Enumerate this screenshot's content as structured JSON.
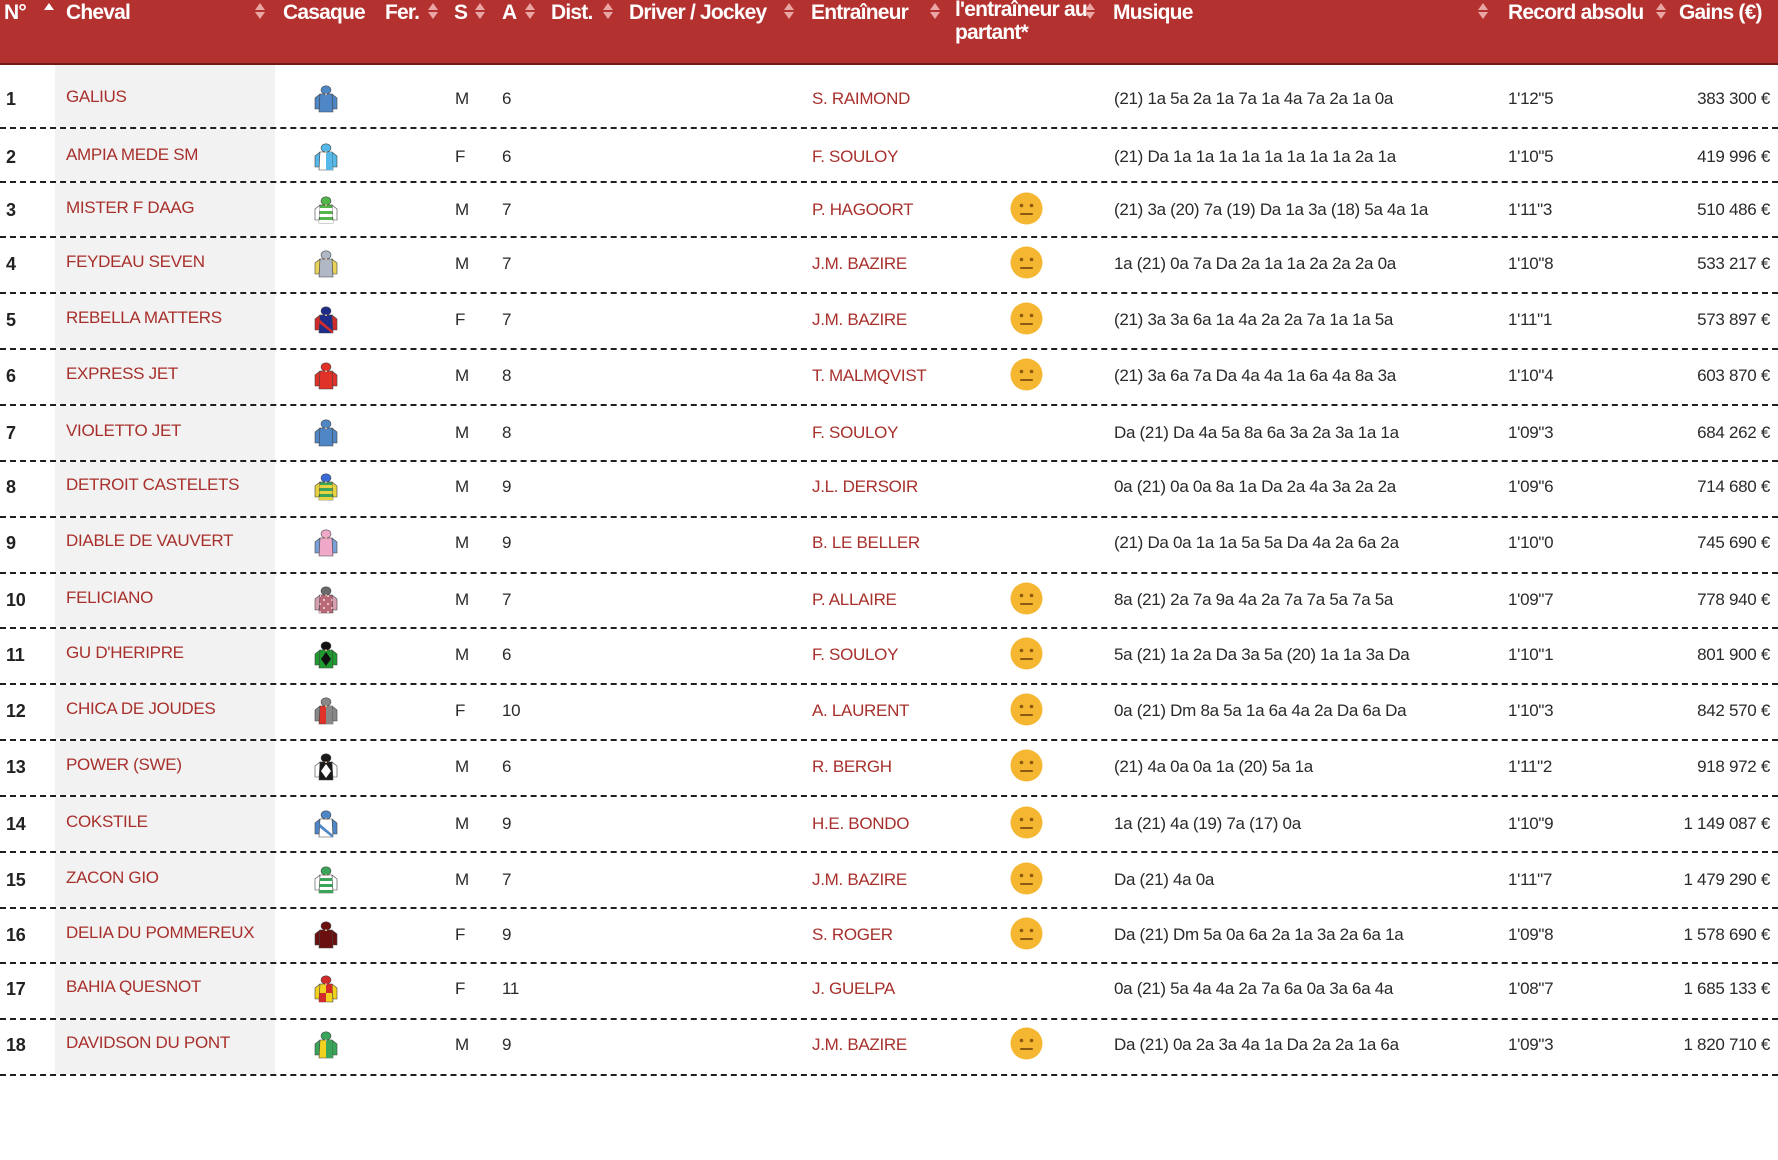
{
  "header": {
    "columns": [
      {
        "label": "N°",
        "sort": "none"
      },
      {
        "label": "Cheval",
        "sort": "asc"
      },
      {
        "label": "Casaque",
        "sort": "none"
      },
      {
        "label": "Fer.",
        "sort": "none"
      },
      {
        "label": "S",
        "sort": "none"
      },
      {
        "label": "A",
        "sort": "none"
      },
      {
        "label": "Dist.",
        "sort": "none"
      },
      {
        "label": "Driver / Jockey",
        "sort": "none"
      },
      {
        "label": "Entraîneur",
        "sort": "none"
      },
      {
        "label": "l'entraîneur au partant*",
        "sort": "none"
      },
      {
        "label": "Musique",
        "sort": "none"
      },
      {
        "label": "Record absolu",
        "sort": "none"
      },
      {
        "label": "Gains (€)",
        "sort": "none"
      }
    ]
  },
  "colors": {
    "header_bg": "#b3312f",
    "link": "#a8302c",
    "smiley": "#f5b731",
    "name_bg": "#f2f2f2"
  },
  "rows": [
    {
      "num": "1",
      "horse": "GALIUS",
      "silk": "blue",
      "sex": "M",
      "age": "6",
      "trainer": "S. RAIMOND",
      "smiley": false,
      "music": "(21) 1a 5a 2a 1a 7a 1a 4a 7a 2a 1a 0a",
      "record": "1'12\"5",
      "gains": "383 300 €"
    },
    {
      "num": "2",
      "horse": "AMPIA MEDE SM",
      "silk": "lightblue-white",
      "sex": "F",
      "age": "6",
      "trainer": "F. SOULOY",
      "smiley": false,
      "music": "(21) Da 1a 1a 1a 1a 1a 1a 1a 1a 2a 1a",
      "record": "1'10\"5",
      "gains": "419 996 €"
    },
    {
      "num": "3",
      "horse": "MISTER F DAAG",
      "silk": "green-stripes",
      "sex": "M",
      "age": "7",
      "trainer": "P. HAGOORT",
      "smiley": true,
      "music": "(21) 3a (20) 7a (19) Da 1a 3a (18) 5a 4a 1a",
      "record": "1'11\"3",
      "gains": "510 486 €"
    },
    {
      "num": "4",
      "horse": "FEYDEAU SEVEN",
      "silk": "grey-yellow",
      "sex": "M",
      "age": "7",
      "trainer": "J.M. BAZIRE",
      "smiley": true,
      "music": "1a (21) 0a 7a Da 2a 1a 1a 2a 2a 2a 0a",
      "record": "1'10\"8",
      "gains": "533 217 €"
    },
    {
      "num": "5",
      "horse": "REBELLA MATTERS",
      "silk": "navy-red",
      "sex": "F",
      "age": "7",
      "trainer": "J.M. BAZIRE",
      "smiley": true,
      "music": "(21) 3a 3a 6a 1a 4a 2a 2a 7a 1a 1a 5a",
      "record": "1'11\"1",
      "gains": "573 897 €"
    },
    {
      "num": "6",
      "horse": "EXPRESS JET",
      "silk": "red",
      "sex": "M",
      "age": "8",
      "trainer": "T. MALMQVIST",
      "smiley": true,
      "music": "(21) 3a 6a 7a Da 4a 4a 1a 6a 4a 8a 3a",
      "record": "1'10\"4",
      "gains": "603 870 €"
    },
    {
      "num": "7",
      "horse": "VIOLETTO JET",
      "silk": "blue",
      "sex": "M",
      "age": "8",
      "trainer": "F. SOULOY",
      "smiley": false,
      "music": "Da (21) Da 4a 5a 8a 6a 3a 2a 3a 1a 1a",
      "record": "1'09\"3",
      "gains": "684 262 €"
    },
    {
      "num": "8",
      "horse": "DETROIT CASTELETS",
      "silk": "green-yellow-blue",
      "sex": "M",
      "age": "9",
      "trainer": "J.L. DERSOIR",
      "smiley": false,
      "music": "0a (21) 0a 0a 8a 1a Da 2a 4a 3a 2a 2a",
      "record": "1'09\"6",
      "gains": "714 680 €"
    },
    {
      "num": "9",
      "horse": "DIABLE DE VAUVERT",
      "silk": "pink",
      "sex": "M",
      "age": "9",
      "trainer": "B. LE BELLER",
      "smiley": false,
      "music": "(21) Da 0a 1a 1a 5a 5a Da 4a 2a 6a 2a",
      "record": "1'10\"0",
      "gains": "745 690 €"
    },
    {
      "num": "10",
      "horse": "FELICIANO",
      "silk": "pink-check",
      "sex": "M",
      "age": "7",
      "trainer": "P. ALLAIRE",
      "smiley": true,
      "music": "8a (21) 2a 7a 9a 4a 2a 7a 7a 5a 7a 5a",
      "record": "1'09\"7",
      "gains": "778 940 €"
    },
    {
      "num": "11",
      "horse": "GU D'HERIPRE",
      "silk": "green-black",
      "sex": "M",
      "age": "6",
      "trainer": "F. SOULOY",
      "smiley": true,
      "music": "5a (21) 1a 2a Da 3a 5a (20) 1a 1a 3a Da",
      "record": "1'10\"1",
      "gains": "801 900 €"
    },
    {
      "num": "12",
      "horse": "CHICA DE JOUDES",
      "silk": "red-grey",
      "sex": "F",
      "age": "10",
      "trainer": "A. LAURENT",
      "smiley": true,
      "music": "0a (21) Dm 8a 5a 1a 6a 4a 2a Da 6a Da",
      "record": "1'10\"3",
      "gains": "842 570 €"
    },
    {
      "num": "13",
      "horse": "POWER (SWE)",
      "silk": "black-white",
      "sex": "M",
      "age": "6",
      "trainer": "R. BERGH",
      "smiley": true,
      "music": "(21) 4a 0a 0a 1a (20) 5a 1a",
      "record": "1'11\"2",
      "gains": "918 972 €"
    },
    {
      "num": "14",
      "horse": "COKSTILE",
      "silk": "blue-white",
      "sex": "M",
      "age": "9",
      "trainer": "H.E. BONDO",
      "smiley": true,
      "music": "1a (21) 4a (19) 7a (17) 0a",
      "record": "1'10\"9",
      "gains": "1 149 087 €"
    },
    {
      "num": "15",
      "horse": "ZACON GIO",
      "silk": "white-green",
      "sex": "M",
      "age": "7",
      "trainer": "J.M. BAZIRE",
      "smiley": true,
      "music": "Da (21) 4a 0a",
      "record": "1'11\"7",
      "gains": "1 479 290 €"
    },
    {
      "num": "16",
      "horse": "DELIA DU POMMEREUX",
      "silk": "maroon",
      "sex": "F",
      "age": "9",
      "trainer": "S. ROGER",
      "smiley": true,
      "music": "Da (21) Dm 5a 0a 6a 2a 1a 3a 2a 6a 1a",
      "record": "1'09\"8",
      "gains": "1 578 690 €"
    },
    {
      "num": "17",
      "horse": "BAHIA QUESNOT",
      "silk": "yellow-red",
      "sex": "F",
      "age": "11",
      "trainer": "J. GUELPA",
      "smiley": false,
      "music": "0a (21) 5a 4a 4a 2a 7a 6a 0a 3a 6a 4a",
      "record": "1'08\"7",
      "gains": "1 685 133 €"
    },
    {
      "num": "18",
      "horse": "DAVIDSON DU PONT",
      "silk": "green-yellow",
      "sex": "M",
      "age": "9",
      "trainer": "J.M. BAZIRE",
      "smiley": true,
      "music": "Da (21) 0a 2a 3a 4a 1a Da 2a 2a 1a 6a",
      "record": "1'09\"3",
      "gains": "1 820 710 €"
    }
  ]
}
